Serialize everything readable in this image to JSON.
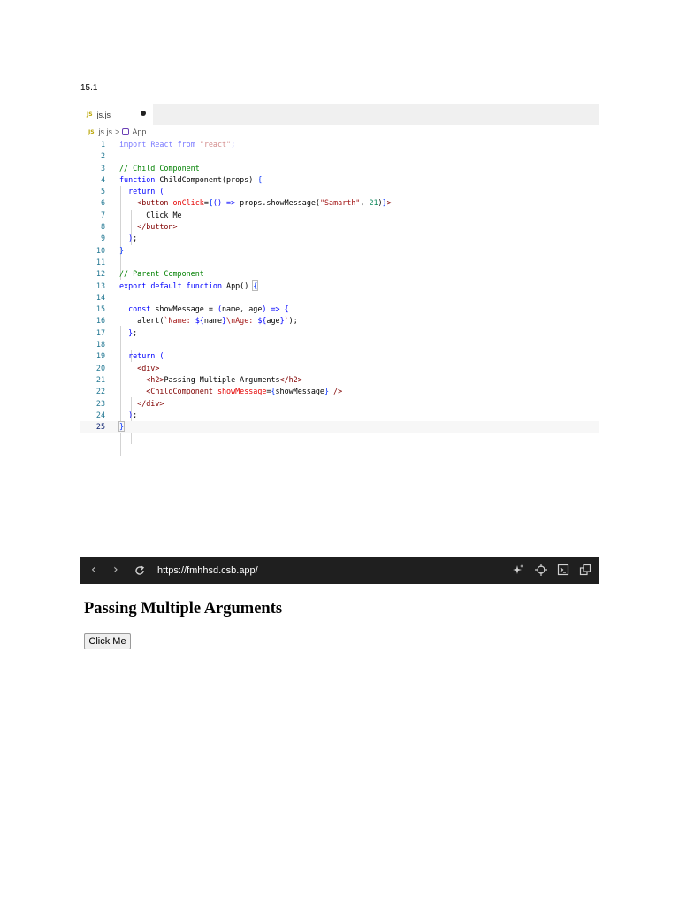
{
  "heading": "15.1",
  "editor": {
    "tab_badge": "JS",
    "tab_name": "js.js",
    "breadcrumb": {
      "file": "js.js",
      "separator": ">",
      "symbol": "App"
    },
    "lines": [
      {
        "n": "1",
        "html": "<span class=\"dim\">import</span> <span class=\"dim\">React</span> <span class=\"dim\">from</span> <span class=\"str\" style=\"color:#d38c8c\">\"react\"</span><span class=\"dim\">;</span>"
      },
      {
        "n": "2",
        "html": ""
      },
      {
        "n": "3",
        "html": "<span class=\"cm\">// Child Component</span>"
      },
      {
        "n": "4",
        "html": "<span class=\"kw\">function</span> ChildComponent(props) <span class=\"bk\">{</span>"
      },
      {
        "n": "5",
        "html": "  <span class=\"kw\">return</span> <span class=\"kw\">(</span>"
      },
      {
        "n": "6",
        "html": "    <span class=\"tag\">&lt;button</span> <span class=\"attr\">onClick</span>=<span class=\"bk\">{</span><span class=\"kw\">()</span> <span class=\"kw\">=&gt;</span> props.showMessage(<span class=\"str\">\"Samarth\"</span>, <span class=\"num\">21</span>)<span class=\"bk\">}</span><span class=\"tag\">&gt;</span>"
      },
      {
        "n": "7",
        "html": "      Click Me"
      },
      {
        "n": "8",
        "html": "    <span class=\"tag\">&lt;/button&gt;</span>"
      },
      {
        "n": "9",
        "html": "  <span class=\"kw\">)</span>;"
      },
      {
        "n": "10",
        "html": "<span class=\"bk\">}</span>"
      },
      {
        "n": "11",
        "html": ""
      },
      {
        "n": "12",
        "html": "<span class=\"cm\">// Parent Component</span>"
      },
      {
        "n": "13",
        "html": "<span class=\"kw\">export</span> <span class=\"kw\">default</span> <span class=\"kw\">function</span> App() <span class=\"bk\" style=\"outline:1px solid #b9b9b9\">{</span>"
      },
      {
        "n": "14",
        "html": ""
      },
      {
        "n": "15",
        "html": "  <span class=\"kw\">const</span> showMessage = <span class=\"kw\">(</span>name, age<span class=\"kw\">)</span> <span class=\"kw\">=&gt;</span> <span class=\"kw\">{</span>"
      },
      {
        "n": "16",
        "html": "    alert(<span class=\"str\">`Name: </span><span class=\"kw\">${</span>name<span class=\"kw\">}</span><span class=\"str\">\\nAge: </span><span class=\"kw\">${</span>age<span class=\"kw\">}</span><span class=\"str\">`</span>);"
      },
      {
        "n": "17",
        "html": "  <span class=\"kw\">}</span>;"
      },
      {
        "n": "18",
        "html": ""
      },
      {
        "n": "19",
        "html": "  <span class=\"kw\">return</span> <span class=\"kw\">(</span>"
      },
      {
        "n": "20",
        "html": "    <span class=\"tag\">&lt;div&gt;</span>"
      },
      {
        "n": "21",
        "html": "      <span class=\"tag\">&lt;h2&gt;</span>Passing Multiple Arguments<span class=\"tag\">&lt;/h2&gt;</span>"
      },
      {
        "n": "22",
        "html": "      <span class=\"tag\">&lt;ChildComponent</span> <span class=\"attr\">showMessage</span>=<span class=\"bk\">{</span>showMessage<span class=\"bk\">}</span> <span class=\"tag\">/&gt;</span>"
      },
      {
        "n": "23",
        "html": "    <span class=\"tag\">&lt;/div&gt;</span>"
      },
      {
        "n": "24",
        "html": "  <span class=\"kw\">)</span>;"
      },
      {
        "n": "25",
        "html": "<span class=\"bk\" style=\"outline:1px solid #b9b9b9\">}</span>"
      }
    ]
  },
  "browser": {
    "back_icon": "chevron-left-icon",
    "forward_icon": "chevron-right-icon",
    "reload_icon": "reload-icon",
    "url": "https://fmhhsd.csb.app/",
    "toolbar_icons": [
      "sparkle-icon",
      "crosshair-icon",
      "terminal-icon",
      "new-window-icon"
    ]
  },
  "preview": {
    "title": "Passing Multiple Arguments",
    "button_label": "Click Me"
  }
}
